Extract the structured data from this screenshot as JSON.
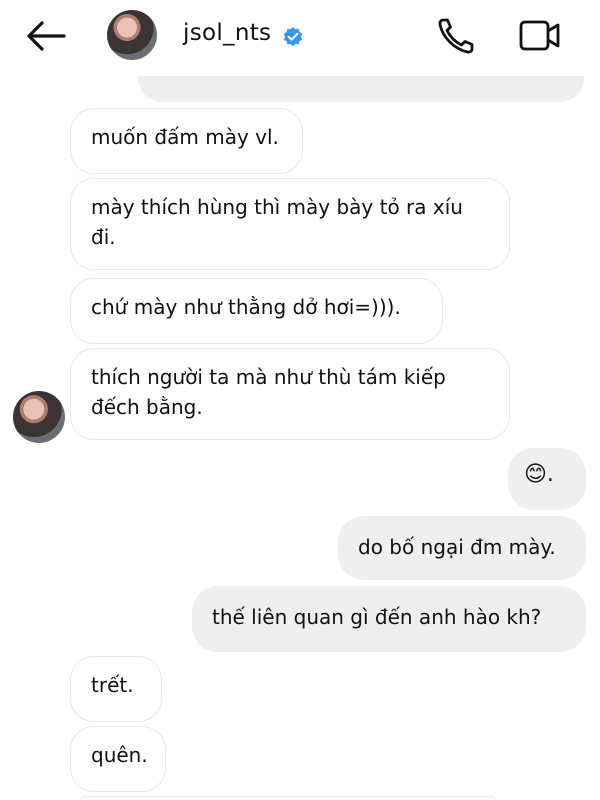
{
  "header": {
    "username": "jsol_nts",
    "icons": {
      "back": "back-arrow-icon",
      "verified": "verified-badge-icon",
      "call": "phone-icon",
      "video": "video-call-icon"
    },
    "colors": {
      "verified": "#3897f0"
    }
  },
  "messages": [
    {
      "side": "received",
      "text": "muốn đấm mày vl."
    },
    {
      "side": "received",
      "text": "mày thích hùng thì mày bày tỏ ra xíu đi."
    },
    {
      "side": "received",
      "text": "chứ mày như thằng dở hơi=)))."
    },
    {
      "side": "received",
      "text": "thích người ta mà như thù tám kiếp đếch bằng."
    },
    {
      "side": "sent",
      "text": "😊."
    },
    {
      "side": "sent",
      "text": "do bố ngại đm mày."
    },
    {
      "side": "sent",
      "text": "thế liên quan gì đến anh hào kh?"
    },
    {
      "side": "received",
      "text": "trết."
    },
    {
      "side": "received",
      "text": "quên."
    }
  ]
}
